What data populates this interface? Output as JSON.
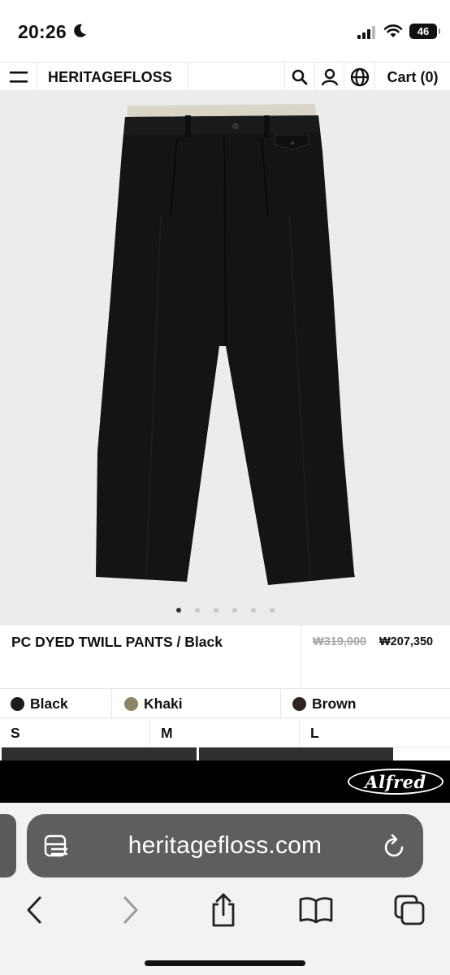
{
  "status_bar": {
    "time": "20:26",
    "battery": "46",
    "icons": [
      "moon-icon",
      "signal-icon",
      "wifi-icon",
      "battery-icon"
    ]
  },
  "header": {
    "brand": "HERITAGEFLOSS",
    "cart_label": "Cart (0)",
    "icons": [
      "menu-icon",
      "search-icon",
      "account-icon",
      "globe-icon"
    ]
  },
  "product": {
    "image": "black-pleated-trousers",
    "title": "PC DYED TWILL PANTS / Black",
    "original_price": "₩319,000",
    "sale_price": "₩207,350",
    "carousel": {
      "total": 6,
      "active": 1
    },
    "colors": [
      {
        "name": "Black",
        "swatch": "#1c1c1c"
      },
      {
        "name": "Khaki",
        "swatch": "#8c8466"
      },
      {
        "name": "Brown",
        "swatch": "#2e2421"
      }
    ],
    "sizes": [
      "S",
      "M",
      "L"
    ]
  },
  "promo": {
    "logo_text": "Alfred",
    "background": "#000000"
  },
  "browser": {
    "url": "heritagefloss.com",
    "toolbar_icons": [
      "back-icon",
      "forward-icon",
      "share-icon",
      "bookmarks-icon",
      "tabs-icon"
    ]
  }
}
